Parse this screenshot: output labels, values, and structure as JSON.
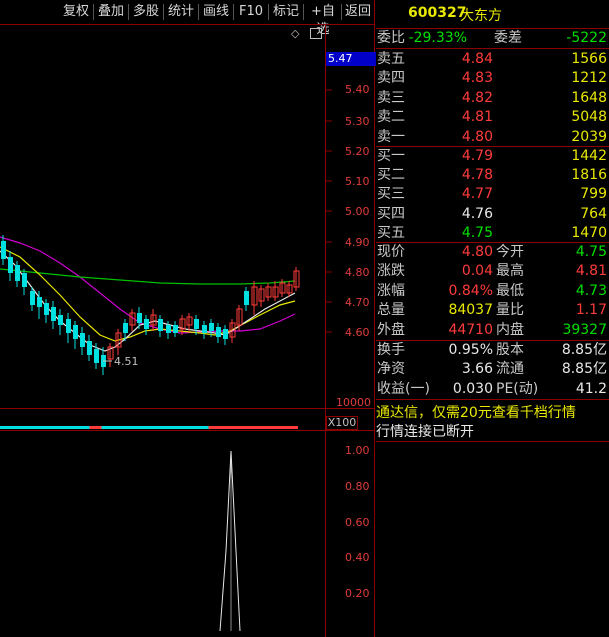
{
  "toolbar": {
    "items": [
      "复权",
      "叠加",
      "多股",
      "统计",
      "画线",
      "F10",
      "标记",
      "+自选",
      "返回"
    ]
  },
  "chart": {
    "current_price_tag": "5.47",
    "y_labels": [
      "5.40",
      "5.30",
      "5.20",
      "5.10",
      "5.00",
      "4.90",
      "4.80",
      "4.70",
      "4.60"
    ],
    "low_annotation": "4.51",
    "volume_label": "10000",
    "volume_unit": "X100",
    "osc_labels": [
      "1.00",
      "0.80",
      "0.60",
      "0.40",
      "0.20"
    ]
  },
  "quote": {
    "code": "600327",
    "name": "大东方",
    "wei_bi_label": "委比",
    "wei_bi_value": "-29.33%",
    "wei_cha_label": "委差",
    "wei_cha_value": "-5222",
    "sell": [
      {
        "label": "卖五",
        "price": "4.84",
        "vol": "1566"
      },
      {
        "label": "卖四",
        "price": "4.83",
        "vol": "1212"
      },
      {
        "label": "卖三",
        "price": "4.82",
        "vol": "1648"
      },
      {
        "label": "卖二",
        "price": "4.81",
        "vol": "5048"
      },
      {
        "label": "卖一",
        "price": "4.80",
        "vol": "2039"
      }
    ],
    "buy": [
      {
        "label": "买一",
        "price": "4.79",
        "vol": "1442"
      },
      {
        "label": "买二",
        "price": "4.78",
        "vol": "1816"
      },
      {
        "label": "买三",
        "price": "4.77",
        "vol": "799"
      },
      {
        "label": "买四",
        "price": "4.76",
        "vol": "764"
      },
      {
        "label": "买五",
        "price": "4.75",
        "vol": "1470"
      }
    ],
    "stats": [
      {
        "l1": "现价",
        "v1": "4.80",
        "l2": "今开",
        "v2": "4.75"
      },
      {
        "l1": "涨跌",
        "v1": "0.04",
        "l2": "最高",
        "v2": "4.81"
      },
      {
        "l1": "涨幅",
        "v1": "0.84%",
        "l2": "最低",
        "v2": "4.73"
      },
      {
        "l1": "总量",
        "v1": "84037",
        "l2": "量比",
        "v2": "1.17"
      },
      {
        "l1": "外盘",
        "v1": "44710",
        "l2": "内盘",
        "v2": "39327"
      }
    ],
    "stats2": [
      {
        "l1": "换手",
        "v1": "0.95%",
        "l2": "股本",
        "v2": "8.85亿"
      },
      {
        "l1": "净资",
        "v1": "3.66",
        "l2": "流通",
        "v2": "8.85亿"
      },
      {
        "l1": "收益(一)",
        "v1": "0.030",
        "l2": "PE(动)",
        "v2": "41.2"
      }
    ],
    "notice": "通达信，仅需20元查看千档行情",
    "status": "行情连接已断开"
  },
  "colors": {
    "up": "#ff3b3b",
    "down": "#00e0e0",
    "grid": "#8b0000"
  }
}
